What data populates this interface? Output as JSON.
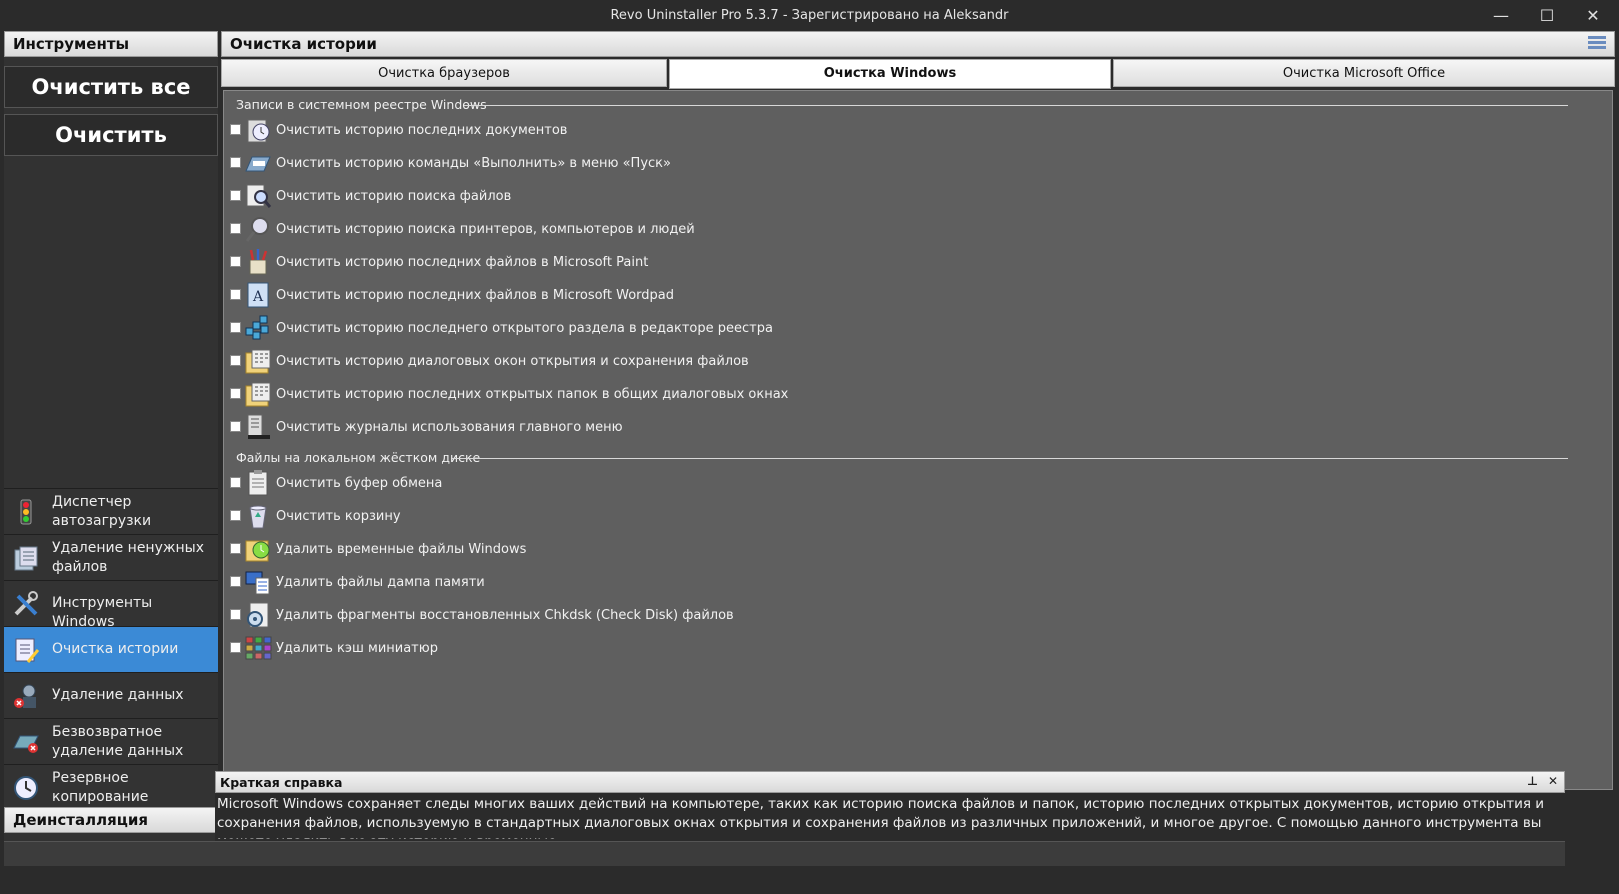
{
  "window": {
    "title": "Revo Uninstaller Pro 5.3.7 - Зарегистрировано на Aleksandr",
    "minimize": "—",
    "maximize": "☐",
    "close": "✕"
  },
  "left": {
    "tools_header": "Инструменты",
    "clean_all": "Очистить все",
    "clean": "Очистить",
    "nav": [
      {
        "line1": "Диспетчер",
        "line2": "автозагрузки",
        "icon": "traffic-light-icon"
      },
      {
        "line1": "Удаление ненужных",
        "line2": "файлов",
        "icon": "junk-files-icon"
      },
      {
        "line1": "Инструменты Windows",
        "line2": "",
        "icon": "tools-icon"
      },
      {
        "line1": "Очистка истории",
        "line2": "",
        "icon": "history-cleaner-icon"
      },
      {
        "line1": "Удаление данных",
        "line2": "",
        "icon": "evidence-remover-icon"
      },
      {
        "line1": "Безвозвратное",
        "line2": "удаление данных",
        "icon": "unrecoverable-delete-icon"
      },
      {
        "line1": "Резервное",
        "line2": "копирование",
        "icon": "backup-clock-icon"
      }
    ],
    "uninstall_header": "Деинсталляция"
  },
  "main": {
    "header": "Очистка истории",
    "tabs": [
      "Очистка браузеров",
      "Очистка Windows",
      "Очистка Microsoft Office"
    ],
    "active_tab": 1,
    "groups": [
      {
        "title": "Записи в системном реестре Windows",
        "items": [
          "Очистить историю последних документов",
          "Очистить историю команды «Выполнить» в меню «Пуск»",
          "Очистить историю поиска файлов",
          "Очистить историю поиска принтеров, компьютеров и людей",
          "Очистить историю последних файлов в Microsoft Paint",
          "Очистить историю последних файлов в Microsoft Wordpad",
          "Очистить историю последнего открытого раздела в редакторе реестра",
          "Очистить историю диалоговых окон открытия и сохранения файлов",
          "Очистить историю последних открытых папок в общих диалоговых окнах",
          "Очистить журналы использования главного меню"
        ]
      },
      {
        "title": "Файлы на локальном жёстком диске",
        "items": [
          "Очистить буфер обмена",
          "Очистить корзину",
          "Удалить временные файлы Windows",
          "Удалить файлы дампа памяти",
          "Удалить фрагменты восстановленных Chkdsk (Check Disk) файлов",
          "Удалить кэш миниатюр"
        ]
      }
    ]
  },
  "help": {
    "header": "Краткая справка",
    "pin": "⊥",
    "close": "✕",
    "text": "Microsoft Windows сохраняет следы многих ваших действий на компьютере, таких как историю поиска файлов и папок, историю последних открытых документов, историю открытия и сохранения файлов, используемую в стандартных диалоговых окнах открытия и сохранения файлов из различных приложений, и многое другое. С помощью данного инструмента вы можете удалить всю эту историю и временные"
  },
  "colors": {
    "accent": "#3b8ad6",
    "content_bg": "#5f5f5f",
    "panel_bg": "#2b2b2b"
  }
}
